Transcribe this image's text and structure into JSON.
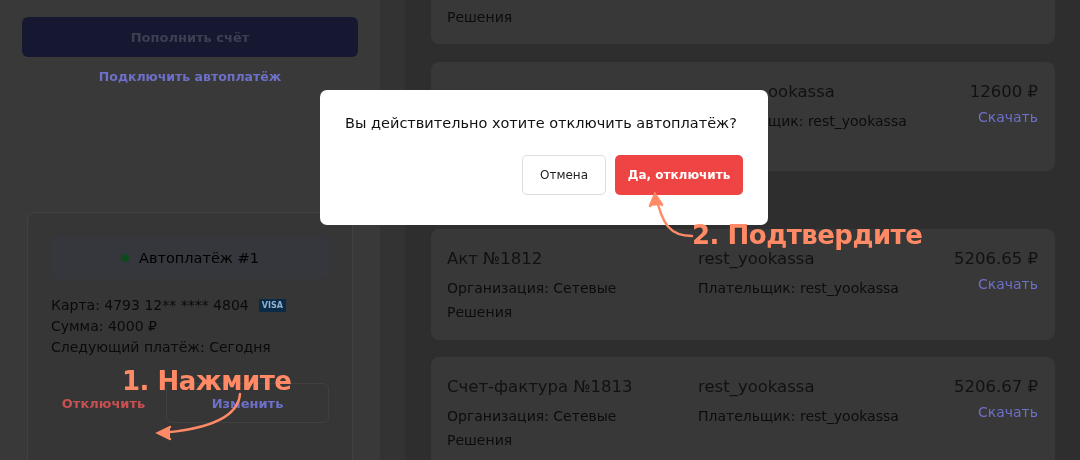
{
  "sidebar": {
    "top_up_button": "Пополнить счёт",
    "autopay_link": "Подключить автоплатёж",
    "autopay": {
      "title": "Автоплатёж #1",
      "active": true,
      "card": "Карта: 4793 12** **** 4804",
      "card_brand": "VISA",
      "amount": "Сумма: 4000 ₽",
      "next_payment": "Следующий платёж: Сегодня",
      "disable_button": "Отключить",
      "edit_button": "Изменить"
    }
  },
  "documents": [
    {
      "organization": "Решения"
    },
    {
      "payer_name": "ookassa",
      "payer": "щик: rest_yookassa",
      "amount": "12600 ₽",
      "download": "Скачать"
    },
    {
      "title": "Акт №1812",
      "organization": "Организация: Сетевые Решения",
      "payer_name": "rest_yookassa",
      "payer": "Плательщик: rest_yookassa",
      "amount": "5206.65 ₽",
      "download": "Скачать"
    },
    {
      "title": "Счет-фактура №1813",
      "organization": "Организация: Сетевые Решения",
      "payer_name": "rest_yookassa",
      "payer": "Плательщик: rest_yookassa",
      "amount": "5206.67 ₽",
      "download": "Скачать"
    }
  ],
  "modal": {
    "message": "Вы действительно хотите отключить автоплатёж?",
    "cancel_button": "Отмена",
    "confirm_button": "Да, отключить"
  },
  "annotations": [
    {
      "text": "1. Нажмите"
    },
    {
      "text": "2. Подтвердите"
    }
  ]
}
